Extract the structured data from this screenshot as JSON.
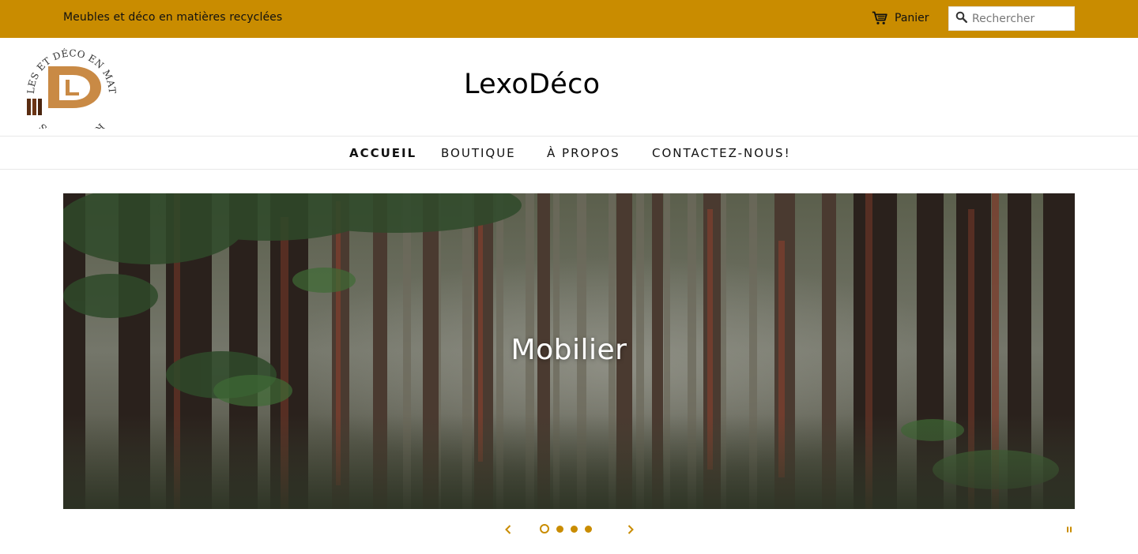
{
  "announcement": {
    "text": "Meubles et déco en matières recyclées"
  },
  "header": {
    "cart_label": "Panier",
    "search_placeholder": "Rechercher",
    "site_title": "LexoDéco",
    "logo": {
      "brand_letters": "DL",
      "seal_text": "Meubles et déco en matières recyclées"
    }
  },
  "nav": {
    "items": [
      {
        "label": "ACCUEIL",
        "active": true
      },
      {
        "label": "BOUTIQUE",
        "active": false
      },
      {
        "label": "À PROPOS",
        "active": false
      },
      {
        "label": "CONTACTEZ-NOUS!",
        "active": false
      }
    ]
  },
  "slideshow": {
    "current_title": "Mobilier",
    "slide_count": 4,
    "current_index": 1,
    "icons": {
      "prev": "chevron-left-icon",
      "next": "chevron-right-icon",
      "pause": "pause-icon"
    }
  },
  "icons": {
    "cart": "cart-icon",
    "search": "search-icon"
  },
  "colors": {
    "accent": "#c98c00",
    "nav_text": "#111111",
    "hero_text": "#ffffff"
  }
}
